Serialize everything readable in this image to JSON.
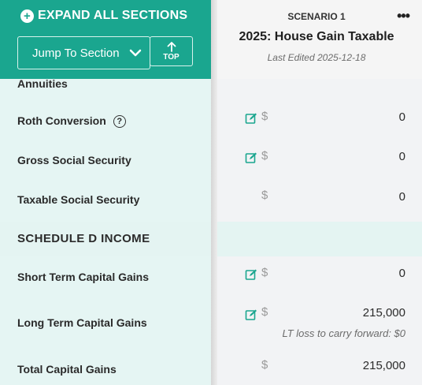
{
  "header": {
    "expand_all_label": "EXPAND ALL SECTIONS",
    "jump_select_value": "Jump To Section",
    "top_button_label": "TOP"
  },
  "scenario": {
    "label": "SCENARIO 1",
    "title": "2025: House Gain Taxable",
    "last_edited": "Last Edited 2025-12-18",
    "more_icon": "•••"
  },
  "rows": [
    {
      "label": "Annuities"
    },
    {
      "label": "Roth Conversion",
      "help_icon": "?",
      "currency": "$",
      "value": "0"
    },
    {
      "label": "Gross Social Security",
      "currency": "$",
      "value": "0"
    },
    {
      "label": "Taxable Social Security",
      "currency": "$",
      "value": "0"
    }
  ],
  "schedule_d": {
    "title": "SCHEDULE D INCOME",
    "rows": [
      {
        "label": "Short Term Capital Gains",
        "currency": "$",
        "value": "0"
      },
      {
        "label": "Long Term Capital Gains",
        "currency": "$",
        "value": "215,000",
        "note": "LT loss to carry forward: $0"
      },
      {
        "label": "Total Capital Gains",
        "currency": "$",
        "value": "215,000"
      }
    ]
  },
  "colors": {
    "brand_teal": "#1aa68f",
    "row_bg": "#e5f5f3",
    "edit_icon": "#1aa68f"
  },
  "icons": {
    "expand": "plus-circle-icon",
    "jump_chevron": "chevron-down-icon",
    "top_arrow": "arrow-up-icon",
    "more": "more-horizontal-icon",
    "edit": "edit-icon",
    "help": "help-circle-icon"
  }
}
